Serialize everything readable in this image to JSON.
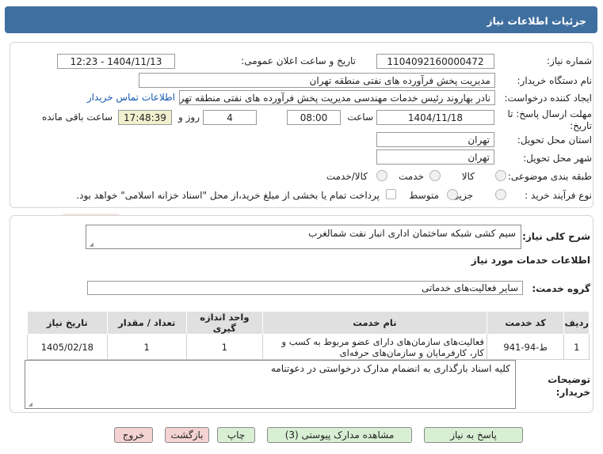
{
  "header": {
    "title": "جزئیات اطلاعات نیاز"
  },
  "form": {
    "need_number_label": "شماره نیاز:",
    "need_number": "1104092160000472",
    "announce_label": "تاریخ و ساعت اعلان عمومی:",
    "announce_value": "1404/11/13 - 12:23",
    "buyer_org_label": "نام دستگاه خریدار:",
    "buyer_org": "مدیریت پخش فرآورده های نفتی منطقه تهران",
    "creator_label": "ایجاد کننده درخواست:",
    "creator": "نادر بهاروند رئیس خدمات مهندسی مدیریت پخش فرآورده های نفتی منطقه تهران",
    "contact_link": "اطلاعات تماس خریدار",
    "deadline_label": "مهلت ارسال پاسخ: تا تاریخ:",
    "deadline_date": "1404/11/18",
    "hour_label": "ساعت",
    "deadline_time": "08:00",
    "days_value": "4",
    "days_label": "روز و",
    "remaining_time": "17:48:39",
    "remaining_label": "ساعت باقی مانده",
    "province_label": "استان محل تحویل:",
    "province": "تهران",
    "city_label": "شهر محل تحویل:",
    "city": "تهران",
    "category_label": "طبقه بندی موضوعی:",
    "category_options": [
      "کالا",
      "خدمت",
      "کالا/خدمت"
    ],
    "process_label": "نوع فرآیند خرید :",
    "process_options": [
      "جزیی",
      "متوسط"
    ],
    "payment_note": "پرداخت تمام یا بخشی از مبلغ خرید،از محل \"اسناد خزانه اسلامی\" خواهد بود."
  },
  "details": {
    "summary_label": "شرح کلی نیاز:",
    "summary": "سیم کشی شبکه ساختمان اداری انبار نفت شمالغرب",
    "services_title": "اطلاعات خدمات مورد نیاز",
    "group_label": "گروه خدمت:",
    "group_value": "سایر فعالیت‌های خدماتی",
    "table": {
      "headers": [
        "ردیف",
        "کد خدمت",
        "نام خدمت",
        "واحد اندازه گیری",
        "تعداد / مقدار",
        "تاریخ نیاز"
      ],
      "rows": [
        [
          "1",
          "ط-94-941",
          "فعالیت‌های سازمان‌های دارای عضو مربوط به کسب و کار، کارفرمایان و سازمان‌های حرفه‌ای",
          "1",
          "1",
          "1405/02/18"
        ]
      ]
    },
    "notes_label": "توضیحات خریدار:",
    "notes": "کلیه اسناد بارگذاری به انضمام مدارک درخواستی در دعوتنامه"
  },
  "buttons": {
    "reply": "پاسخ به نیاز",
    "attachments": "مشاهده مدارک پیوستی (3)",
    "print": "چاپ",
    "back": "بازگشت",
    "exit": "خروج"
  },
  "watermark": "AriaTender.neT"
}
